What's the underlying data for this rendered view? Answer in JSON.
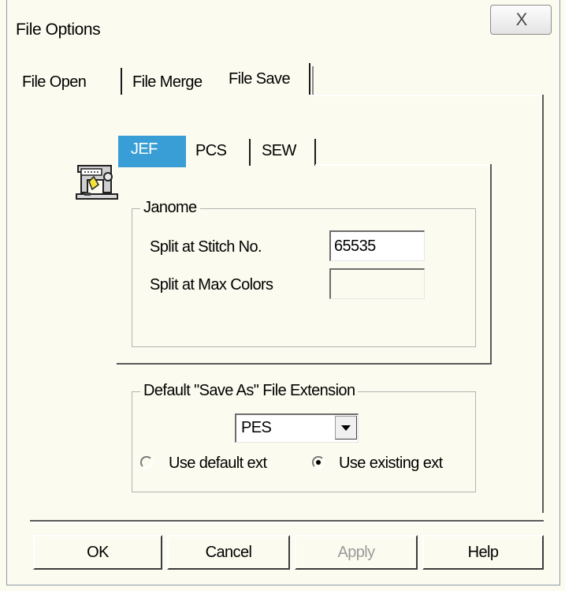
{
  "window": {
    "title": "File Options",
    "close_glyph": "X"
  },
  "outer_tabs": [
    {
      "label": "File Open",
      "selected": false
    },
    {
      "label": "File Merge",
      "selected": false
    },
    {
      "label": "File Save",
      "selected": true
    }
  ],
  "inner_tabs": [
    {
      "label": "JEF",
      "selected": true
    },
    {
      "label": "PCS",
      "selected": false
    },
    {
      "label": "SEW",
      "selected": false
    }
  ],
  "icons": {
    "machine": "sewing-machine-icon",
    "close": "close-icon",
    "dropdown": "chevron-down-icon"
  },
  "janome_group": {
    "label": "Janome",
    "split_stitch_label": "Split at Stitch No.",
    "split_stitch_value": "65535",
    "split_colors_label": "Split at Max Colors",
    "split_colors_value": ""
  },
  "save_as_group": {
    "label": "Default \"Save As\" File Extension",
    "extension_value": "PES",
    "radio_default_label": "Use default ext",
    "radio_default_checked": false,
    "radio_existing_label": "Use existing ext",
    "radio_existing_checked": true
  },
  "buttons": {
    "ok": "OK",
    "cancel": "Cancel",
    "apply": "Apply",
    "apply_enabled": false,
    "help": "Help"
  },
  "colors": {
    "background": "#fbfbef",
    "tab_selected": "#3a9ed6"
  }
}
